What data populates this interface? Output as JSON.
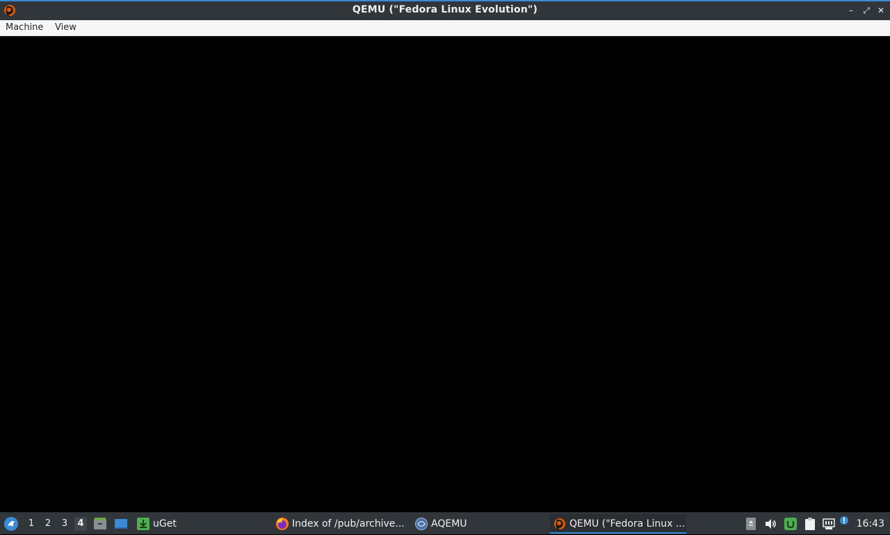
{
  "window": {
    "title": "QEMU (\"Fedora Linux Evolution\")",
    "controls": {
      "minimize": "–",
      "maximize": "⤢",
      "close": "✕"
    }
  },
  "menubar": {
    "items": [
      "Machine",
      "View"
    ]
  },
  "taskbar": {
    "workspaces": [
      "1",
      "2",
      "3",
      "4"
    ],
    "active_workspace": "4",
    "tasks": [
      {
        "label": "uGet",
        "icon": "uget-icon"
      },
      {
        "label": "Index of /pub/archive...",
        "icon": "firefox-icon"
      },
      {
        "label": "AQEMU",
        "icon": "aqemu-icon"
      },
      {
        "label": "QEMU (\"Fedora Linux ...",
        "icon": "qemu-icon",
        "active": true
      }
    ],
    "clock": "16:43"
  },
  "colors": {
    "titlebar": "#31363b",
    "accent": "#3b8ad6",
    "menubar": "#f7f7f7",
    "screen": "#000000"
  }
}
